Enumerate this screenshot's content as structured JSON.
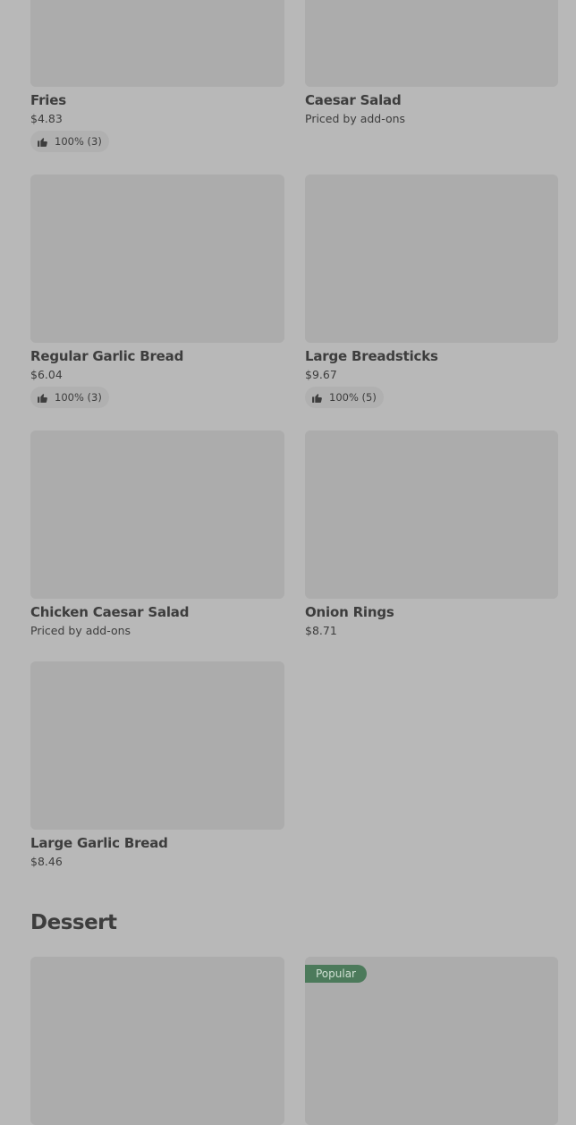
{
  "items": [
    {
      "name": "Fries",
      "price": "$4.83",
      "rating": "100% (3)"
    },
    {
      "name": "Caesar Salad",
      "price": "Priced by add-ons"
    },
    {
      "name": "Regular Garlic Bread",
      "price": "$6.04",
      "rating": "100% (3)"
    },
    {
      "name": "Large Breadsticks",
      "price": "$9.67",
      "rating": "100% (5)"
    },
    {
      "name": "Chicken Caesar Salad",
      "price": "Priced by add-ons"
    },
    {
      "name": "Onion Rings",
      "price": "$8.71"
    },
    {
      "name": "Large Garlic Bread",
      "price": "$8.46"
    }
  ],
  "dessert": {
    "title": "Dessert",
    "badge": "Popular"
  },
  "icons": {
    "rating": "thumbs-up-icon"
  }
}
